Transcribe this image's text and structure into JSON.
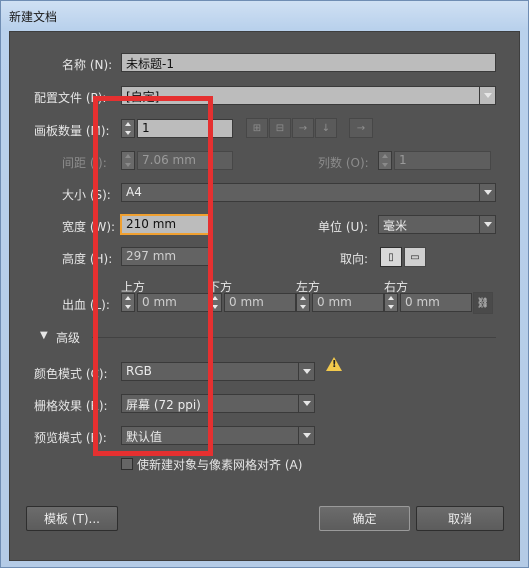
{
  "window": {
    "title": "新建文档"
  },
  "form": {
    "name_label": "名称 (N):",
    "name_value": "未标题-1",
    "profile_label": "配置文件 (P):",
    "profile_value": "[自定]",
    "artboards_label": "画板数量 (M):",
    "artboards_value": "1",
    "spacing_label": "间距 (I):",
    "spacing_value": "7.06 mm",
    "columns_label": "列数 (O):",
    "columns_value": "1",
    "size_label": "大小 (S):",
    "size_value": "A4",
    "width_label": "宽度 (W):",
    "width_value": "210 mm",
    "units_label": "单位 (U):",
    "units_value": "毫米",
    "height_label": "高度 (H):",
    "height_value": "297 mm",
    "orientation_label": "取向:",
    "bleed_label": "出血 (L):",
    "bleed_top_label": "上方",
    "bleed_bottom_label": "下方",
    "bleed_left_label": "左方",
    "bleed_right_label": "右方",
    "bleed_top": "0 mm",
    "bleed_bottom": "0 mm",
    "bleed_left": "0 mm",
    "bleed_right": "0 mm",
    "advanced_label": "高级",
    "color_mode_label": "颜色模式 (C):",
    "color_mode_value": "RGB",
    "raster_label": "栅格效果 (R):",
    "raster_value": "屏幕 (72 ppi)",
    "preview_label": "预览模式 (E):",
    "preview_value": "默认值",
    "align_checkbox_label": "使新建对象与像素网格对齐 (A)"
  },
  "buttons": {
    "templates": "模板 (T)...",
    "ok": "确定",
    "cancel": "取消"
  },
  "colors": {
    "panel_bg": "#535353",
    "highlight_box": "#e53030",
    "field_focus": "#f0a030",
    "warning": "#f2c94c"
  },
  "icons": {
    "arrange_grid_row": "grid-by-row-icon",
    "arrange_grid_col": "grid-by-column-icon",
    "arrange_row": "arrange-by-row-icon",
    "arrange_col": "arrange-by-column-icon",
    "layout_rtl": "right-to-left-icon",
    "portrait": "portrait-icon",
    "landscape": "landscape-icon",
    "link": "chain-link-icon",
    "warning": "warning-icon"
  }
}
